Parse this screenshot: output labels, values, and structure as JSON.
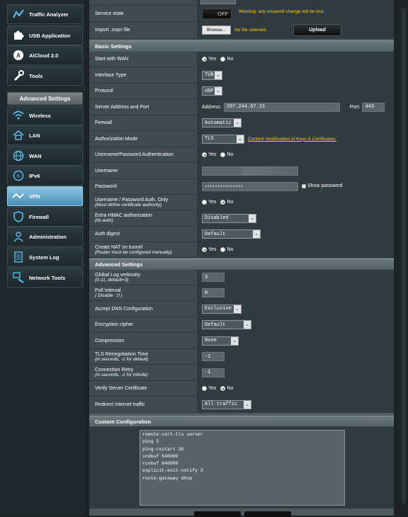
{
  "sidebar": {
    "general_items": [
      {
        "label": "Traffic Analyzer",
        "icon": "traffic-analyzer-icon"
      },
      {
        "label": "USB Application",
        "icon": "puzzle-icon"
      },
      {
        "label": "AiCloud 2.0",
        "icon": "cloud-icon"
      },
      {
        "label": "Tools",
        "icon": "wrench-icon"
      }
    ],
    "advanced_header": "Advanced Settings",
    "advanced_items": [
      {
        "label": "Wireless",
        "icon": "wifi-icon"
      },
      {
        "label": "LAN",
        "icon": "home-icon"
      },
      {
        "label": "WAN",
        "icon": "globe-icon"
      },
      {
        "label": "IPv6",
        "icon": "ipv6-icon"
      },
      {
        "label": "VPN",
        "icon": "vpn-icon",
        "active": true
      },
      {
        "label": "Firewall",
        "icon": "shield-icon"
      },
      {
        "label": "Administration",
        "icon": "admin-icon"
      },
      {
        "label": "System Log",
        "icon": "log-icon"
      },
      {
        "label": "Network Tools",
        "icon": "network-tools-icon"
      }
    ]
  },
  "top": {
    "service_state_label": "Service state",
    "toggle_text": "OFF",
    "warning": "Warning: any unsaved change will be lost.",
    "import_label": "Import .ovpn file",
    "browse_label": "Browse...",
    "no_file": "No file selected.",
    "upload_label": "Upload"
  },
  "basic": {
    "title": "Basic Settings",
    "start_with_wan": {
      "label": "Start with WAN",
      "yes": "Yes",
      "no": "No"
    },
    "interface_type": {
      "label": "Interface Type",
      "value": "TUN"
    },
    "protocol": {
      "label": "Protocol",
      "value": "UDP"
    },
    "server": {
      "label": "Server Address and Port",
      "address_label": "Address:",
      "address": "207.244.67.21",
      "port_label": "Port:",
      "port": "443"
    },
    "firewall": {
      "label": "Firewall",
      "value": "Automatic"
    },
    "auth_mode": {
      "label": "Authorization Mode",
      "value": "TLS",
      "link": "Content modification of Keys & Certificates."
    },
    "userpass_auth": {
      "label": "Username/Password Authentication",
      "yes": "Yes",
      "no": "No"
    },
    "username": {
      "label": "Username"
    },
    "password": {
      "label": "Password",
      "value": "•••••••••••••••",
      "show": "Show password"
    },
    "userpass_only": {
      "label": "Username / Password Auth. Only",
      "sub": "(Must define certificate authority)",
      "yes": "Yes",
      "no": "No"
    },
    "hmac": {
      "label": "Extra HMAC authorization",
      "sub": "(tls-auth)",
      "value": "Disabled"
    },
    "auth_digest": {
      "label": "Auth digest",
      "value": "Default"
    },
    "nat": {
      "label": "Create NAT on tunnel",
      "sub": "(Router must be configured manually)",
      "yes": "Yes",
      "no": "No"
    }
  },
  "advanced": {
    "title": "Advanced Settings",
    "log_verbosity": {
      "label": "Global Log verbosity",
      "sub": "(0-11, default=3)",
      "value": "3"
    },
    "poll": {
      "label": "Poll Interval",
      "sub": "( Disable : 0 )",
      "value": "0"
    },
    "dns": {
      "label": "Accept DNS Configuration",
      "value": "Exclusive"
    },
    "cipher": {
      "label": "Encryption cipher",
      "value": "Default"
    },
    "compression": {
      "label": "Compression",
      "value": "None"
    },
    "tls_reneg": {
      "label": "TLS Renegotiation Time",
      "sub": "(in seconds, -1 for default)",
      "value": "-1"
    },
    "retry": {
      "label": "Connection Retry",
      "sub": "(in seconds, -1 for infinite)",
      "value": "-1"
    },
    "verify": {
      "label": "Verify Server Certificate",
      "yes": "Yes",
      "no": "No"
    },
    "redirect": {
      "label": "Redirect Internet traffic",
      "value": "All traffic"
    }
  },
  "custom": {
    "title": "Custom Configuration",
    "lines": [
      "remote-cert-tls server",
      "ping 5",
      "ping-restart 30",
      "sndbuf 640000",
      "rcvbuf 640000",
      "explicit-exit-notify 3",
      "route-gateway dhcp"
    ]
  }
}
